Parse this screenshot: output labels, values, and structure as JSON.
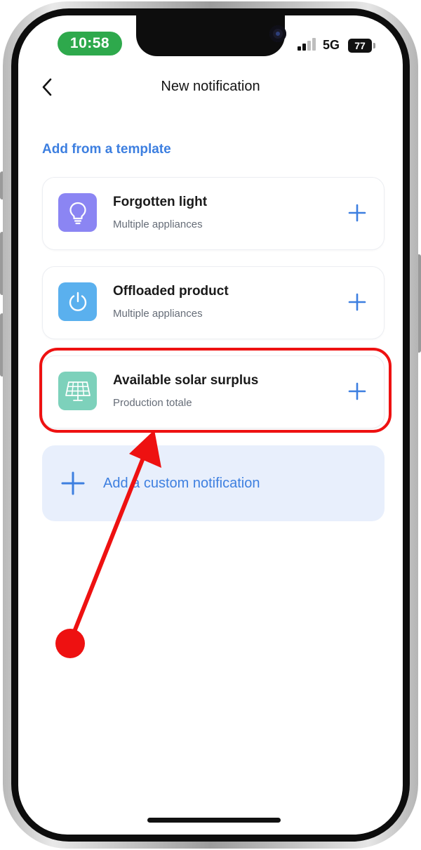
{
  "status_bar": {
    "time": "10:58",
    "network": "5G",
    "battery": "77"
  },
  "header": {
    "title": "New notification"
  },
  "templates": {
    "section_title": "Add from a template",
    "items": [
      {
        "title": "Forgotten light",
        "subtitle": "Multiple appliances",
        "icon": "lightbulb-icon",
        "color": "#8b85f3"
      },
      {
        "title": "Offloaded product",
        "subtitle": "Multiple appliances",
        "icon": "power-icon",
        "color": "#5ab0ee"
      },
      {
        "title": "Available solar surplus",
        "subtitle": "Production totale",
        "icon": "solar-panel-icon",
        "color": "#7dd1bb"
      }
    ]
  },
  "custom": {
    "label": "Add a custom notification"
  },
  "colors": {
    "accent": "#3d7fe0",
    "status_green": "#2ea94c",
    "annotation_red": "#ee1111",
    "custom_bg": "#e8effc"
  }
}
